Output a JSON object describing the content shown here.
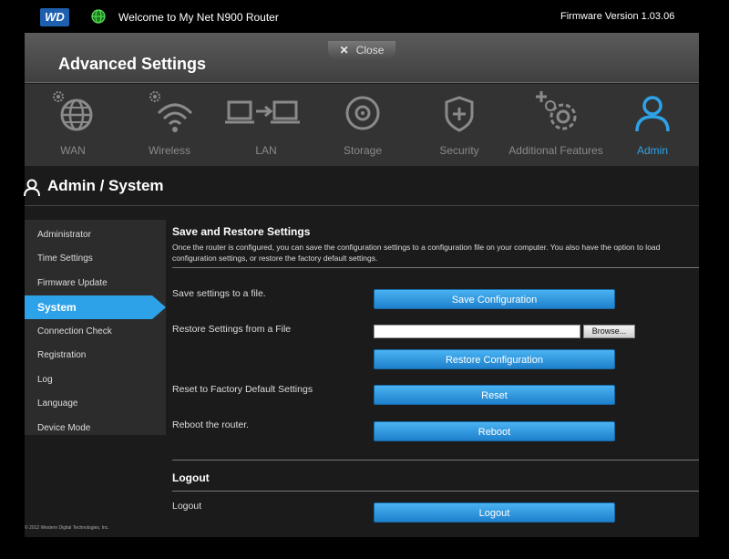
{
  "header": {
    "logo_text": "WD",
    "welcome": "Welcome to My Net N900 Router",
    "firmware": "Firmware Version 1.03.06"
  },
  "advanced": {
    "title": "Advanced Settings",
    "close_label": "Close"
  },
  "nav": {
    "items": [
      {
        "label": "WAN",
        "icon": "globe-gear-icon"
      },
      {
        "label": "Wireless",
        "icon": "wifi-gear-icon"
      },
      {
        "label": "LAN",
        "icon": "lan-laptops-icon"
      },
      {
        "label": "Storage",
        "icon": "disk-icon"
      },
      {
        "label": "Security",
        "icon": "shield-icon"
      },
      {
        "label": "Additional Features",
        "icon": "gears-plus-icon"
      },
      {
        "label": "Admin",
        "icon": "user-icon"
      }
    ],
    "active": "Admin"
  },
  "page": {
    "title": "Admin / System"
  },
  "sidebar": {
    "items": [
      {
        "label": "Administrator"
      },
      {
        "label": "Time Settings"
      },
      {
        "label": "Firmware Update"
      },
      {
        "label": "System"
      },
      {
        "label": "Connection Check"
      },
      {
        "label": "Registration"
      },
      {
        "label": "Log"
      },
      {
        "label": "Language"
      },
      {
        "label": "Device Mode"
      }
    ],
    "active": "System"
  },
  "save_restore": {
    "title": "Save and Restore Settings",
    "description": "Once the router is configured, you can save the configuration settings to a configuration file on your computer. You also have the option to load configuration settings, or restore the factory default settings.",
    "save_label": "Save settings to a file.",
    "save_button": "Save Configuration",
    "restore_label": "Restore Settings from a File",
    "file_value": "",
    "browse_button": "Browse...",
    "restore_button": "Restore Configuration",
    "reset_label": "Reset to Factory Default Settings",
    "reset_button": "Reset",
    "reboot_label": "Reboot the router.",
    "reboot_button": "Reboot"
  },
  "logout": {
    "title": "Logout",
    "label": "Logout",
    "button": "Logout"
  },
  "footer": {
    "copyright": "© 2012 Western Digital Technologies, Inc."
  },
  "colors": {
    "accent": "#2ea2e8",
    "nav_inactive": "#8a8a8a",
    "background": "#1b1b1b"
  }
}
